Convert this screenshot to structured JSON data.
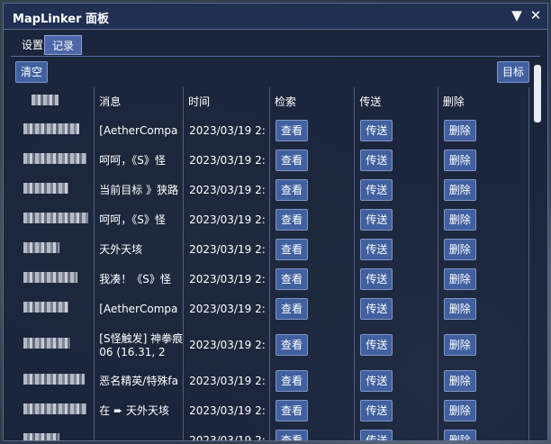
{
  "window": {
    "title": "MapLinker 面板"
  },
  "tabs": [
    {
      "label": "设置",
      "active": false
    },
    {
      "label": "记录",
      "active": true
    }
  ],
  "toolbar": {
    "clear_label": "清空",
    "target_label": "目标"
  },
  "table": {
    "headers": [
      "消息",
      "时间",
      "检索",
      "传送",
      "删除"
    ],
    "view_label": "查看",
    "teleport_label": "传送",
    "delete_label": "删除",
    "rows": [
      {
        "msg1": "[AetherCompa",
        "msg2": "",
        "time": "2023/03/19 2:"
      },
      {
        "msg1": "呵呵，《S》怪",
        "msg2": "",
        "time": "2023/03/19 2:"
      },
      {
        "msg1": "当前目标 》狭路",
        "msg2": "",
        "time": "2023/03/19 2:"
      },
      {
        "msg1": "呵呵，《S》怪",
        "msg2": "",
        "time": "2023/03/19 2:"
      },
      {
        "msg1": "天外天垓",
        "msg2": "",
        "time": "2023/03/19 2:"
      },
      {
        "msg1": "我凑！《S》怪",
        "msg2": "",
        "time": "2023/03/19 2:"
      },
      {
        "msg1": "[AetherCompa",
        "msg2": "",
        "time": "2023/03/19 2:"
      },
      {
        "msg1": "[S怪触发] 神拳痕",
        "msg2": "06 (16.31, 2",
        "time": "2023/03/19 2:"
      },
      {
        "msg1": "恶名精英/特殊fa",
        "msg2": "",
        "time": "2023/03/19 2:"
      },
      {
        "msg1": "在 ➨ 天外天垓",
        "msg2": "",
        "time": "2023/03/19 2:"
      },
      {
        "msg1": "",
        "msg2": "",
        "time": "2023/03/19 2:"
      }
    ]
  },
  "colors": {
    "window_bg": "#18223a",
    "title_bg": "#212f52",
    "button_bg": "#41609f",
    "button_border": "#7f95c8",
    "text": "#ffffff"
  },
  "icons": [
    "collapse-triangle-icon",
    "close-x-icon",
    "data-center-icon"
  ]
}
